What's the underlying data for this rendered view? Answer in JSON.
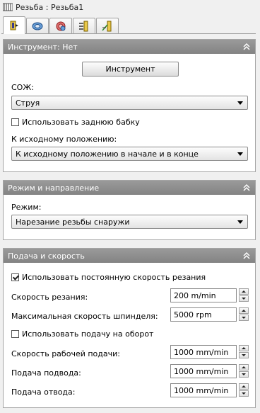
{
  "window": {
    "title": "Резьба : Резьба1",
    "title_icon": "thread-feature-icon"
  },
  "tabs": [
    {
      "icon": "tool-tab-icon",
      "active": true
    },
    {
      "icon": "thread-tab-icon",
      "active": false
    },
    {
      "icon": "gear-tab-icon",
      "active": false
    },
    {
      "icon": "levels-tab-icon",
      "active": false
    },
    {
      "icon": "entry-exit-tab-icon",
      "active": false
    }
  ],
  "tool_panel": {
    "header": "Инструмент: Нет",
    "tool_button": "Инструмент",
    "coolant_label": "СОЖ:",
    "coolant_value": "Струя",
    "tailstock_label": "Использовать заднюю бабку",
    "tailstock_checked": false,
    "home_label": "К исходному положению:",
    "home_value": "К исходному положению в начале и в конце"
  },
  "mode_panel": {
    "header": "Режим и направление",
    "mode_label": "Режим:",
    "mode_value": "Нарезание резьбы снаружи"
  },
  "feed_panel": {
    "header": "Подача и скорость",
    "css_label": "Использовать постоянную скорость резания",
    "css_checked": true,
    "cut_speed_label": "Скорость резания:",
    "cut_speed_value": "200 m/min",
    "max_spindle_label": "Максимальная скорость шпинделя:",
    "max_spindle_value": "5000 rpm",
    "feed_per_rev_label": "Использовать подачу на оборот",
    "feed_per_rev_checked": false,
    "work_feed_label": "Скорость рабочей подачи:",
    "work_feed_value": "1000 mm/min",
    "approach_label": "Подача подвода:",
    "approach_value": "1000 mm/min",
    "retract_label": "Подача отвода:",
    "retract_value": "1000 mm/min"
  },
  "colors": {
    "header_bg": "#8f8f8f",
    "panel_bg": "#ffffff",
    "window_bg": "#f0f0f0"
  }
}
